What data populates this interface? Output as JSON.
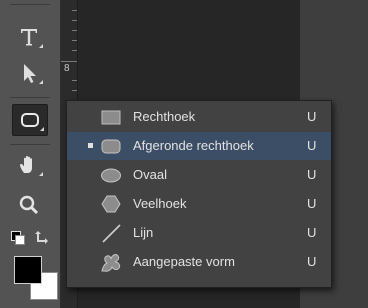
{
  "ruler": {
    "mark": "8"
  },
  "tools": [
    {
      "name": "text-tool",
      "icon": "type-icon"
    },
    {
      "name": "path-selection-tool",
      "icon": "arrow-icon"
    },
    {
      "name": "rounded-rectangle-tool",
      "icon": "rounded-rect-icon",
      "active": true
    },
    {
      "name": "hand-tool",
      "icon": "hand-icon"
    },
    {
      "name": "zoom-tool",
      "icon": "zoom-icon"
    }
  ],
  "shape_menu": {
    "items": [
      {
        "label": "Rechthoek",
        "shortcut": "U",
        "icon": "rectangle-icon",
        "selected": false
      },
      {
        "label": "Afgeronde rechthoek",
        "shortcut": "U",
        "icon": "rounded-rectangle-icon",
        "selected": true
      },
      {
        "label": "Ovaal",
        "shortcut": "U",
        "icon": "ellipse-icon",
        "selected": false
      },
      {
        "label": "Veelhoek",
        "shortcut": "U",
        "icon": "polygon-icon",
        "selected": false
      },
      {
        "label": "Lijn",
        "shortcut": "U",
        "icon": "line-icon",
        "selected": false
      },
      {
        "label": "Aangepaste vorm",
        "shortcut": "U",
        "icon": "custom-shape-icon",
        "selected": false
      }
    ]
  },
  "colors": {
    "foreground": "#000000",
    "background": "#ffffff",
    "selection": "#3b4e66"
  }
}
